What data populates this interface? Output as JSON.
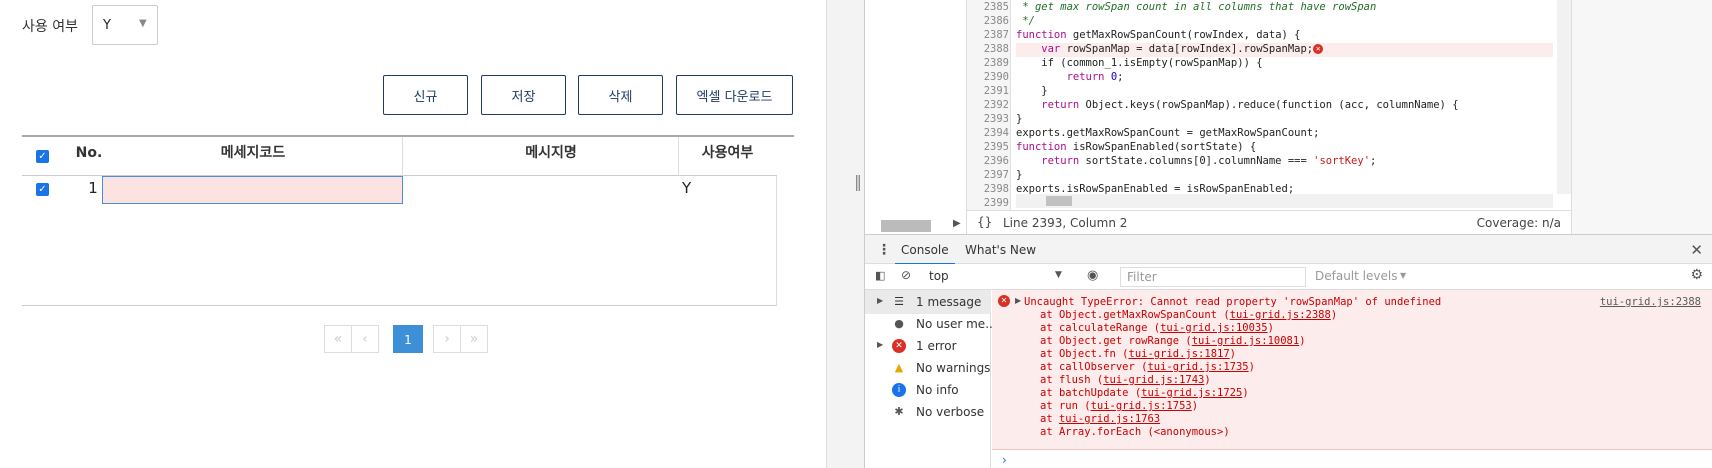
{
  "app": {
    "filter_label": "사용 여부",
    "filter_value": "Y",
    "buttons": {
      "new": "신규",
      "save": "저장",
      "delete": "삭제",
      "excel": "엑셀 다운로드"
    },
    "grid": {
      "headers": {
        "no": "No.",
        "code": "메세지코드",
        "name": "메시지명",
        "use": "사용여부"
      },
      "rows": [
        {
          "no": "1",
          "code": "",
          "name": "",
          "use": "Y"
        }
      ]
    },
    "pager": {
      "first": "«",
      "prev": "‹",
      "current": "1",
      "next": "›",
      "last": "»"
    }
  },
  "devtools": {
    "line_numbers": [
      "2385",
      "2386",
      "2387",
      "2388",
      "2389",
      "2390",
      "2391",
      "2392",
      "2393",
      "2394",
      "2395",
      "2396",
      "2397",
      "2398",
      "2399"
    ],
    "code": {
      "l2385": " * get max rowSpan count in all columns that have rowSpan",
      "l2386": " */",
      "l2387_kw": "function",
      "l2387_rest": " getMaxRowSpanCount(rowIndex, data) {",
      "l2388_kw": "    var",
      "l2388_rest": " rowSpanMap = data[rowIndex].rowSpanMap;",
      "l2389": "    if (common_1.isEmpty(rowSpanMap)) {",
      "l2390_kw": "        return",
      "l2390_num": " 0",
      "l2390_end": ";",
      "l2391": "    }",
      "l2392_kw": "    return",
      "l2392_rest": " Object.keys(rowSpanMap).reduce(function (acc, columnName) {",
      "l2393": "}",
      "l2394": "exports.getMaxRowSpanCount = getMaxRowSpanCount;",
      "l2395_kw": "function",
      "l2395_rest": " isRowSpanEnabled(sortState) {",
      "l2396_kw": "    return",
      "l2396_mid": " sortState.columns[0].columnName === ",
      "l2396_str": "'sortKey'",
      "l2396_end": ";",
      "l2397": "}",
      "l2398": "exports.isRowSpanEnabled = isRowSpanEnabled;",
      "l2399": ""
    },
    "status": {
      "braces": "{}",
      "position": "Line 2393, Column 2",
      "coverage": "Coverage: n/a"
    },
    "tabs": {
      "console": "Console",
      "whats_new": "What's New"
    },
    "toolbar": {
      "context": "top",
      "filter_placeholder": "Filter",
      "levels": "Default levels"
    },
    "sidebar": [
      {
        "label": "1 message",
        "icon": "list-icon"
      },
      {
        "label": "No user me...",
        "icon": "user-icon"
      },
      {
        "label": "1 error",
        "icon": "error-icon"
      },
      {
        "label": "No warnings",
        "icon": "warning-icon"
      },
      {
        "label": "No info",
        "icon": "info-icon"
      },
      {
        "label": "No verbose",
        "icon": "bug-icon"
      }
    ],
    "error": {
      "message": "Uncaught TypeError: Cannot read property 'rowSpanMap' of undefined",
      "source": "tui-grid.js:2388",
      "stack": [
        {
          "pre": "at Object.getMaxRowSpanCount (",
          "link": "tui-grid.js:2388",
          "post": ")"
        },
        {
          "pre": "at calculateRange (",
          "link": "tui-grid.js:10035",
          "post": ")"
        },
        {
          "pre": "at Object.get rowRange (",
          "link": "tui-grid.js:10081",
          "post": ")"
        },
        {
          "pre": "at Object.fn (",
          "link": "tui-grid.js:1817",
          "post": ")"
        },
        {
          "pre": "at callObserver (",
          "link": "tui-grid.js:1735",
          "post": ")"
        },
        {
          "pre": "at flush (",
          "link": "tui-grid.js:1743",
          "post": ")"
        },
        {
          "pre": "at batchUpdate (",
          "link": "tui-grid.js:1725",
          "post": ")"
        },
        {
          "pre": "at run (",
          "link": "tui-grid.js:1753",
          "post": ")"
        },
        {
          "pre": "at ",
          "link": "tui-grid.js:1763",
          "post": ""
        },
        {
          "pre": "at Array.forEach (<anonymous>)",
          "link": "",
          "post": ""
        }
      ]
    },
    "prompt": "›"
  }
}
